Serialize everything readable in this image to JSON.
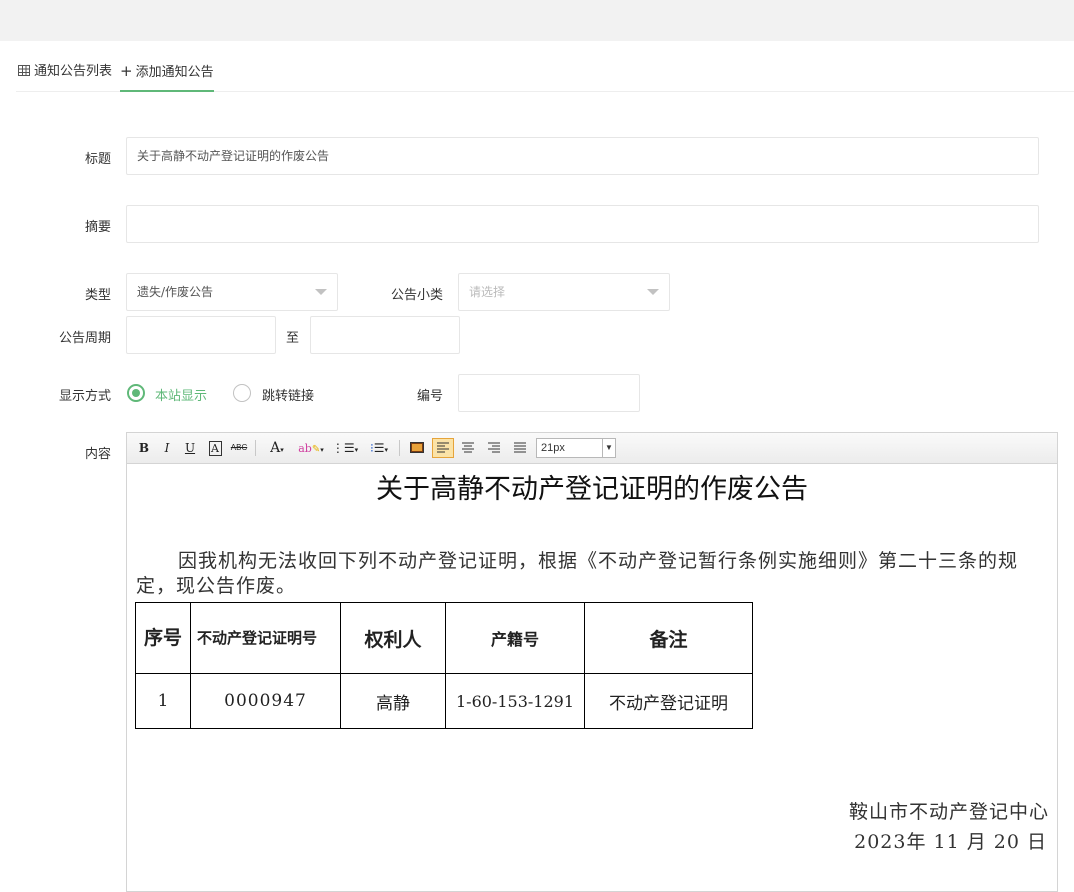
{
  "tabs": [
    {
      "icon": "table-icon",
      "label": "通知公告列表"
    },
    {
      "icon": "plus-icon",
      "label": "添加通知公告"
    }
  ],
  "form": {
    "title_label": "标题",
    "title_value": "关于高静不动产登记证明的作废公告",
    "summary_label": "摘要",
    "summary_value": "",
    "type_label": "类型",
    "type_value": "遗失/作废公告",
    "subtype_label": "公告小类",
    "subtype_placeholder": "请选择",
    "period_label": "公告周期",
    "period_to": "至",
    "display_label": "显示方式",
    "display_options": [
      "本站显示",
      "跳转链接"
    ],
    "display_selected": "本站显示",
    "number_label": "编号",
    "content_label": "内容"
  },
  "editor": {
    "toolbar": {
      "bold": "B",
      "italic": "I",
      "underline": "U",
      "font_color_letter": "A",
      "strike": "ABC",
      "font_size": "21px"
    },
    "doc": {
      "title": "关于高静不动产登记证明的作废公告",
      "paragraph": "因我机构无法收回下列不动产登记证明，根据《不动产登记暂行条例实施细则》第二十三条的规定，现公告作废。",
      "table_headers": [
        "序号",
        "不动产登记证明号",
        "权利人",
        "产籍号",
        "备注"
      ],
      "table_rows": [
        [
          "1",
          "0000947",
          "高静",
          "1-60-153-1291",
          "不动产登记证明"
        ]
      ],
      "signature_org": "鞍山市不动产登记中心",
      "signature_date": "2023年 11 月 20 日"
    }
  },
  "colors": {
    "accent": "#5FB878",
    "border": "#e6e6e6",
    "topbar": "#f2f2f2"
  }
}
